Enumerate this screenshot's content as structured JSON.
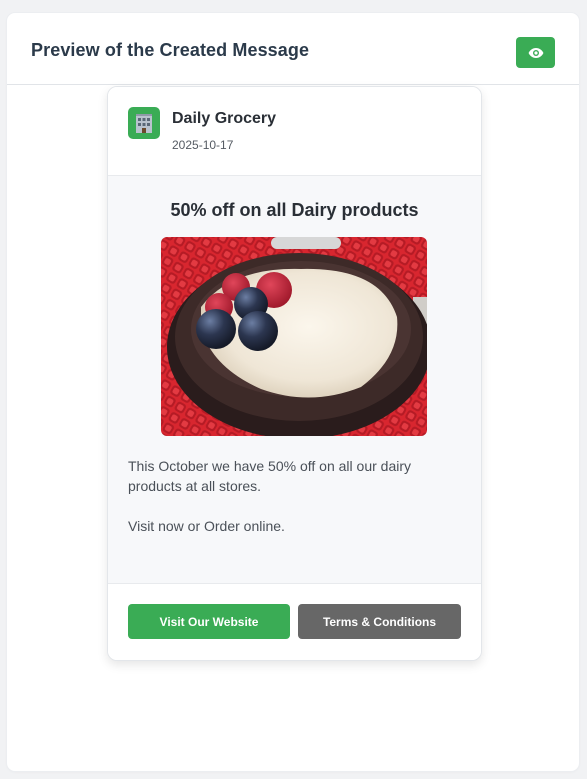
{
  "panel": {
    "title": "Preview of the Created Message",
    "preview_icon": "eye-icon"
  },
  "message": {
    "sender": {
      "name": "Daily Grocery",
      "date": "2025-10-17",
      "avatar_icon": "building-icon"
    },
    "title": "50% off on all Dairy products",
    "image_alt": "Bowl of yogurt topped with raspberries and blueberries",
    "paragraphs": [
      "This October we have 50% off on all our dairy products at all stores.",
      "Visit now or Order online."
    ],
    "buttons": {
      "website": "Visit Our Website",
      "terms": "Terms & Conditions"
    }
  },
  "colors": {
    "primary": "#3aac55",
    "secondary": "#676767",
    "title_text": "#2b3a4a"
  }
}
